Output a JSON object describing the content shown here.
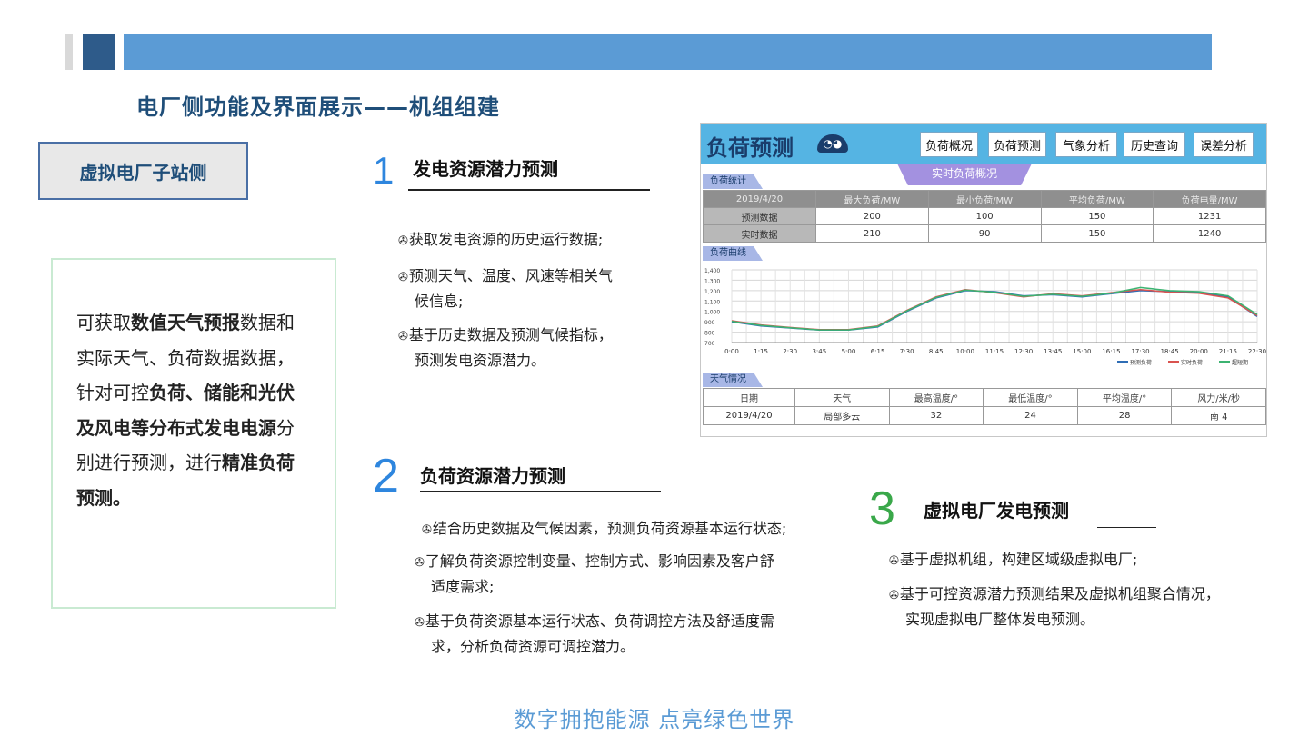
{
  "header": {
    "title": "电厂侧功能及界面展示——机组组建"
  },
  "side_tag": "虚拟电厂子站侧",
  "description": {
    "p1": "可获取",
    "b1": "数值天气预报",
    "p2": "数据和实际天气、负荷数据数据，  针对可控",
    "b2": "负荷、储能和光伏及风电等分布式发电电源",
    "p3": "分别进行预测，进行",
    "b3": "精准负荷预测。"
  },
  "sections": [
    {
      "num": "1",
      "title": "发电资源潜力预测",
      "bullets": [
        {
          "icon": "✇",
          "line1": "获取发电资源的历史运行数据;",
          "line2": ""
        },
        {
          "icon": "✇",
          "line1": "预测天气、温度、风速等相关气",
          "line2": "候信息;"
        },
        {
          "icon": "✇",
          "line1": "基于历史数据及预测气候指标，",
          "line2": "预测发电资源潜力。"
        }
      ]
    },
    {
      "num": "2",
      "title": "负荷资源潜力预测",
      "bullets": [
        {
          "icon": "✇",
          "line1": "结合历史数据及气候因素，预测负荷资源基本运行状态;",
          "line2": ""
        },
        {
          "icon": "✇",
          "line1": "了解负荷资源控制变量、控制方式、影响因素及客户舒",
          "line2": "适度需求;"
        },
        {
          "icon": "✇",
          "line1": "基于负荷资源基本运行状态、负荷调控方法及舒适度需",
          "line2": "求，分析负荷资源可调控潜力。"
        }
      ]
    },
    {
      "num": "3",
      "title": "虚拟电厂发电预测",
      "bullets": [
        {
          "icon": "✇",
          "line1": "基于虚拟机组，构建区域级虚拟电厂;",
          "line2": ""
        },
        {
          "icon": "✇",
          "line1": "基于可控资源潜力预测结果及虚拟机组聚合情况，",
          "line2": "实现虚拟电厂整体发电预测。"
        }
      ]
    }
  ],
  "screenshot": {
    "title": "负荷预测",
    "tabs": [
      "负荷概况",
      "负荷预测",
      "气象分析",
      "历史查询",
      "误差分析"
    ],
    "banner": "实时负荷概况",
    "stats_tag": "负荷统计",
    "stats_header": [
      "2019/4/20",
      "最大负荷/MW",
      "最小负荷/MW",
      "平均负荷/MW",
      "负荷电量/MW"
    ],
    "stats_rows": [
      [
        "预测数据",
        "200",
        "100",
        "150",
        "1231"
      ],
      [
        "实时数据",
        "210",
        "90",
        "150",
        "1240"
      ]
    ],
    "curve_tag": "负荷曲线",
    "weather_tag": "天气情况",
    "weather_header": [
      "日期",
      "天气",
      "最高温度/°",
      "最低温度/°",
      "平均温度/°",
      "风力/米/秒"
    ],
    "weather_rows": [
      [
        "2019/4/20",
        "局部多云",
        "32",
        "24",
        "28",
        "南 4"
      ]
    ]
  },
  "chart_data": {
    "type": "line",
    "title": "",
    "xlabel": "",
    "ylabel": "",
    "x": [
      "0:00",
      "1:15",
      "2:30",
      "3:45",
      "5:00",
      "6:15",
      "7:30",
      "8:45",
      "10:00",
      "11:15",
      "12:30",
      "13:45",
      "15:00",
      "16:15",
      "17:30",
      "18:45",
      "20:00",
      "21:15",
      "22:30"
    ],
    "y_ticks": [
      "1,400",
      "1,300",
      "1,200",
      "1,100",
      "1,000",
      "900",
      "800",
      "700"
    ],
    "ylim": [
      700,
      1400
    ],
    "grid": true,
    "legend_position": "bottom-right",
    "series": [
      {
        "name": "预测负荷",
        "color": "#2f6db5",
        "values": [
          900,
          860,
          840,
          820,
          820,
          850,
          1000,
          1130,
          1200,
          1190,
          1150,
          1160,
          1140,
          1170,
          1200,
          1190,
          1180,
          1140,
          950
        ]
      },
      {
        "name": "实时负荷",
        "color": "#d9534f",
        "values": [
          910,
          870,
          845,
          825,
          825,
          860,
          1010,
          1140,
          1210,
          1180,
          1140,
          1170,
          1150,
          1180,
          1210,
          1185,
          1175,
          1130,
          960
        ]
      },
      {
        "name": "超短期",
        "color": "#3cb371",
        "values": [
          905,
          865,
          842,
          822,
          822,
          855,
          1005,
          1135,
          1205,
          1185,
          1145,
          1165,
          1145,
          1175,
          1230,
          1200,
          1190,
          1150,
          970
        ]
      }
    ]
  },
  "footer": {
    "slogan": "数字拥抱能源   点亮绿色世界"
  }
}
